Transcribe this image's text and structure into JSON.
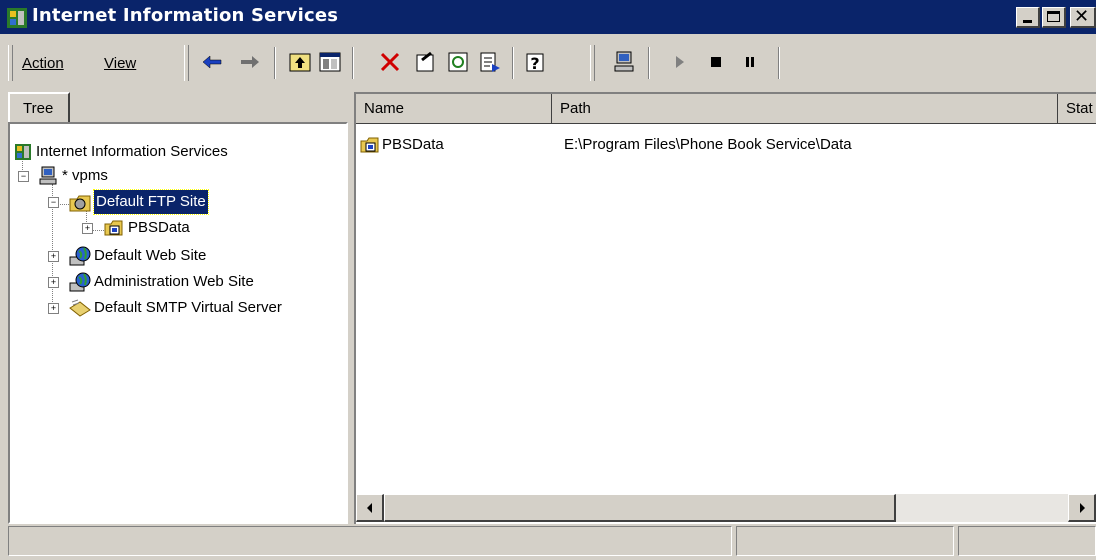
{
  "window": {
    "title": "Internet Information Services"
  },
  "menu": {
    "action": "Action",
    "view": "View"
  },
  "tabs": {
    "tree": "Tree"
  },
  "tree": {
    "root": "Internet Information Services",
    "server": "* vpms",
    "ftp_site": "Default FTP Site",
    "ftp_child": "PBSData",
    "web_site": "Default Web Site",
    "admin_site": "Administration Web Site",
    "smtp": "Default SMTP Virtual Server"
  },
  "details": {
    "columns": [
      "Name",
      "Path",
      "Stat"
    ],
    "rows": [
      {
        "name": "PBSData",
        "path": "E:\\Program Files\\Phone Book Service\\Data"
      }
    ]
  },
  "colors": {
    "titlebar": "#0a246a",
    "face": "#d4d0c8",
    "selection": "#0a246a"
  }
}
